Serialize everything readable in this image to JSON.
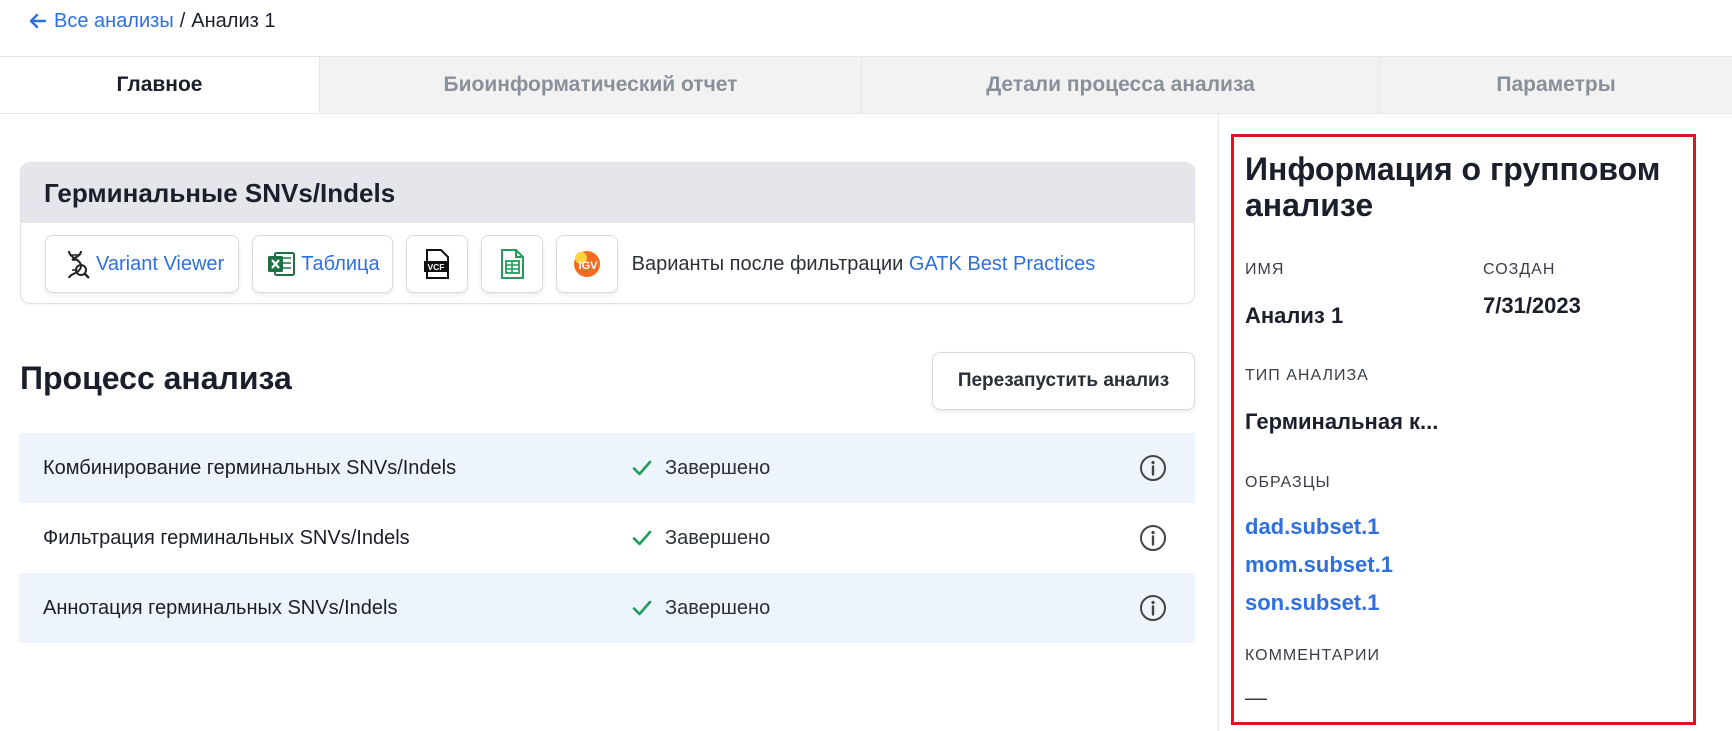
{
  "breadcrumb": {
    "back_label": "Все анализы",
    "separator": "/",
    "current": "Анализ 1"
  },
  "tabs": [
    {
      "label": "Главное",
      "active": true
    },
    {
      "label": "Биоинформатический отчет",
      "active": false
    },
    {
      "label": "Детали процесса анализа",
      "active": false
    },
    {
      "label": "Параметры",
      "active": false
    }
  ],
  "germline_card": {
    "title": "Герминальные SNVs/Indels",
    "variant_viewer_label": "Variant Viewer",
    "table_label": "Таблица",
    "vcf_icon_text": "VCF",
    "igv_icon_text": "IGV",
    "variants_text": "Варианты после фильтрации",
    "variants_link": "GATK Best Practices"
  },
  "process": {
    "title": "Процесс анализа",
    "restart_label": "Перезапустить анализ",
    "steps": [
      {
        "name": "Комбинирование герминальных SNVs/Indels",
        "status": "Завершено"
      },
      {
        "name": "Фильтрация герминальных SNVs/Indels",
        "status": "Завершено"
      },
      {
        "name": "Аннотация герминальных SNVs/Indels",
        "status": "Завершено"
      }
    ]
  },
  "info_panel": {
    "title": "Информация о групповом анализе",
    "name_label": "ИМЯ",
    "name_value": "Анализ 1",
    "created_label": "СОЗДАН",
    "created_value": "7/31/2023",
    "type_label": "ТИП АНАЛИЗА",
    "type_value": "Герминальная к...",
    "samples_label": "ОБРАЗЦЫ",
    "samples": [
      "dad.subset.1",
      "mom.subset.1",
      "son.subset.1"
    ],
    "comments_label": "КОММЕНТАРИИ",
    "comments_value": "—"
  },
  "colors": {
    "accent": "#2f6fde",
    "success": "#1e9e5a",
    "highlight_border": "#e0141e",
    "row_shade": "#edf4fc"
  }
}
